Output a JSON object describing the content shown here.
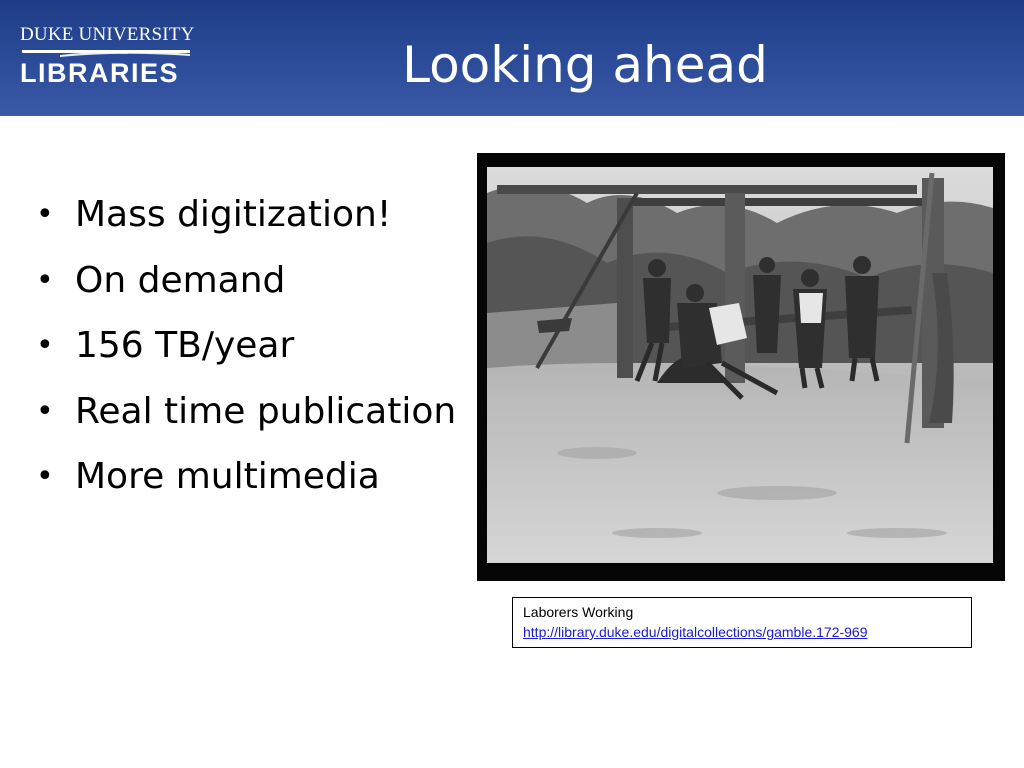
{
  "header": {
    "logo": {
      "line1": "DUKE UNIVERSITY",
      "line2": "LIBRARIES"
    },
    "title": "Looking ahead",
    "background_color": "#2c4c9a"
  },
  "bullets": [
    {
      "label": "Mass digitization!"
    },
    {
      "label": "On demand"
    },
    {
      "label": "156 TB/year"
    },
    {
      "label": "Real time publication"
    },
    {
      "label": "More multimedia"
    }
  ],
  "bullet_symbol": "•",
  "photo": {
    "style": "black-and-white historical photograph",
    "border_color": "#050505"
  },
  "caption": {
    "title": "Laborers Working",
    "link_text": "http://library.duke.edu/digitalcollections/gamble.172-969",
    "link_color": "#1a1ad8"
  }
}
